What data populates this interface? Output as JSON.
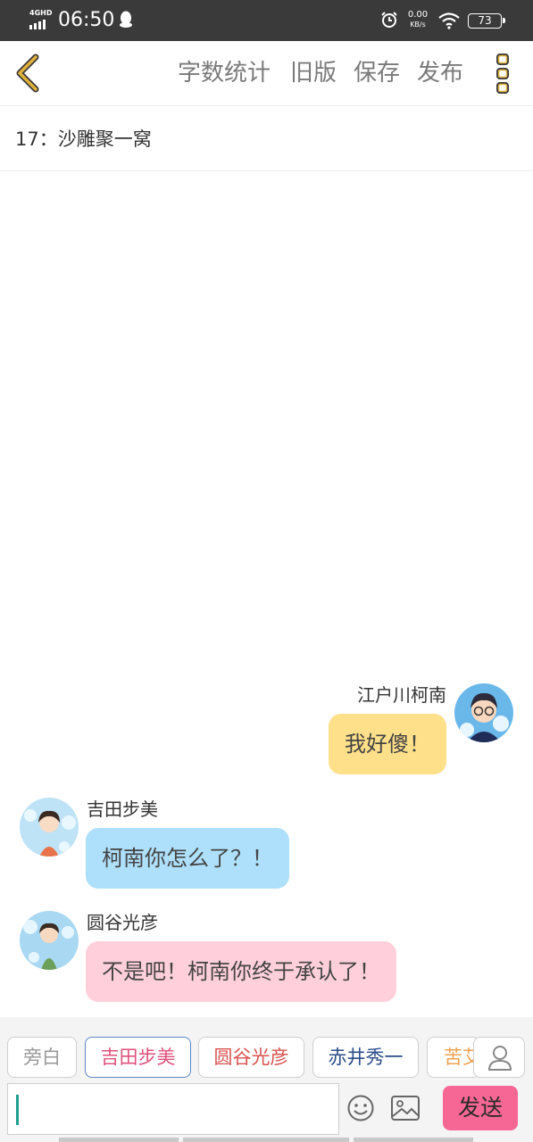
{
  "status_bar": {
    "network": "4GHD",
    "time": "06:50",
    "speed_value": "0.00",
    "speed_unit": "KB/s",
    "battery": "73"
  },
  "toolbar": {
    "word_count": "字数统计",
    "old_version": "旧版",
    "save": "保存",
    "publish": "发布"
  },
  "chapter": {
    "title": "17：沙雕聚一窝"
  },
  "messages": [
    {
      "speaker": "江户川柯南",
      "text": "我好傻！",
      "side": "right",
      "bubble_color": "#ffe08a"
    },
    {
      "speaker": "吉田步美",
      "text": "柯南你怎么了？！",
      "side": "left",
      "bubble_color": "#aee0fc"
    },
    {
      "speaker": "圆谷光彦",
      "text": "不是吧！柯南你终于承认了！",
      "side": "left",
      "bubble_color": "#ffd0dc"
    }
  ],
  "characters": [
    {
      "name": "旁白",
      "color": "#999999"
    },
    {
      "name": "吉田步美",
      "color": "#e0507e",
      "selected": true
    },
    {
      "name": "圆谷光彦",
      "color": "#d9534f"
    },
    {
      "name": "赤井秀一",
      "color": "#2c4e8a"
    },
    {
      "name": "苦艾",
      "color": "#f0a050"
    }
  ],
  "composer": {
    "send": "发送"
  },
  "colors": {
    "accent_back": "#e0b13a",
    "send_button": "#f76796"
  }
}
